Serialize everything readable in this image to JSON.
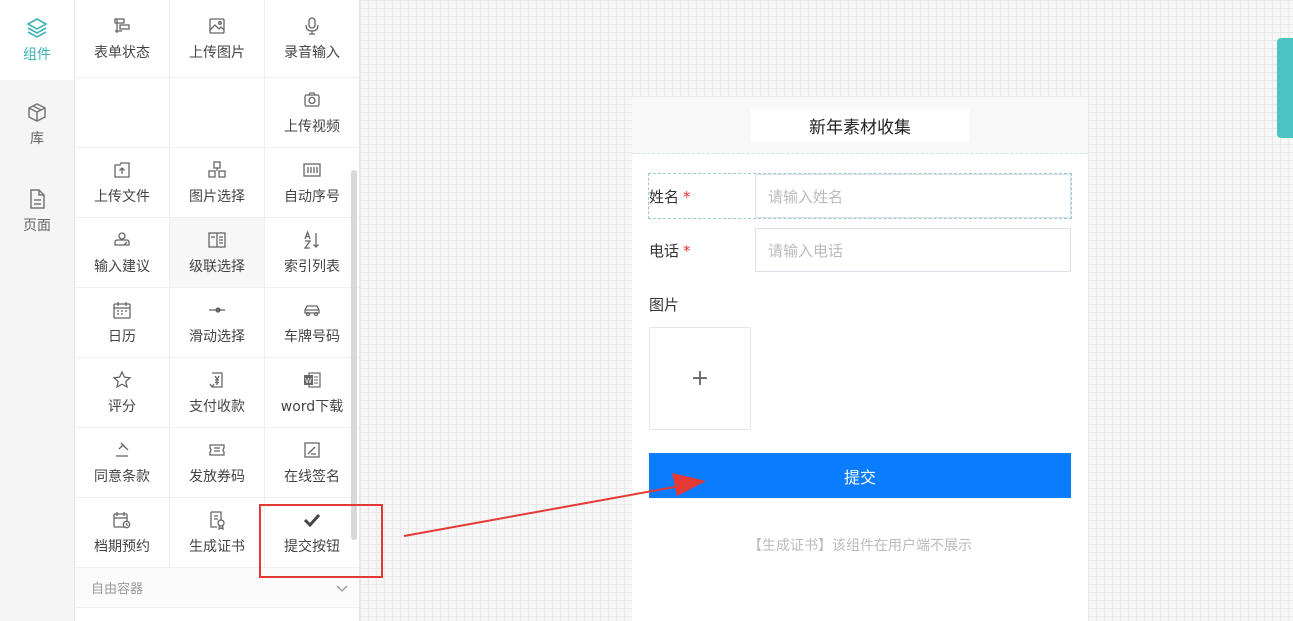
{
  "rail": {
    "items": [
      {
        "label": "组件",
        "icon": "layers-icon",
        "active": true
      },
      {
        "label": "库",
        "icon": "box-icon"
      },
      {
        "label": "页面",
        "icon": "page-icon"
      }
    ]
  },
  "components": {
    "row1": [
      {
        "label": "表单状态",
        "icon": "form-status-icon"
      },
      {
        "label": "上传图片",
        "icon": "image-upload-icon"
      },
      {
        "label": "录音输入",
        "icon": "mic-icon"
      }
    ],
    "row2": [
      {
        "label": "上传视频",
        "icon": "video-upload-icon"
      }
    ],
    "grid": [
      {
        "label": "上传文件",
        "icon": "file-upload-icon"
      },
      {
        "label": "图片选择",
        "icon": "image-select-icon"
      },
      {
        "label": "自动序号",
        "icon": "serial-icon"
      },
      {
        "label": "输入建议",
        "icon": "input-suggest-icon"
      },
      {
        "label": "级联选择",
        "icon": "cascade-icon"
      },
      {
        "label": "索引列表",
        "icon": "sort-az-icon"
      },
      {
        "label": "日历",
        "icon": "calendar-icon"
      },
      {
        "label": "滑动选择",
        "icon": "slider-icon"
      },
      {
        "label": "车牌号码",
        "icon": "car-icon"
      },
      {
        "label": "评分",
        "icon": "star-icon"
      },
      {
        "label": "支付收款",
        "icon": "payment-icon"
      },
      {
        "label": "word下载",
        "icon": "word-icon"
      },
      {
        "label": "同意条款",
        "icon": "agree-icon"
      },
      {
        "label": "发放券码",
        "icon": "coupon-icon"
      },
      {
        "label": "在线签名",
        "icon": "signature-icon"
      },
      {
        "label": "档期预约",
        "icon": "schedule-icon"
      },
      {
        "label": "生成证书",
        "icon": "certificate-icon"
      },
      {
        "label": "提交按钮",
        "icon": "check-icon"
      }
    ],
    "section_label": "自由容器"
  },
  "form": {
    "title": "新年素材收集",
    "name_label": "姓名",
    "name_placeholder": "请输入姓名",
    "phone_label": "电话",
    "phone_placeholder": "请输入电话",
    "required_mark": "*",
    "image_label": "图片",
    "upload_plus": "+",
    "submit_label": "提交",
    "note": "【生成证书】该组件在用户端不展示"
  },
  "colors": {
    "accent": "#3cb4b4",
    "submit": "#0a7cff",
    "annotation": "#e53935"
  }
}
